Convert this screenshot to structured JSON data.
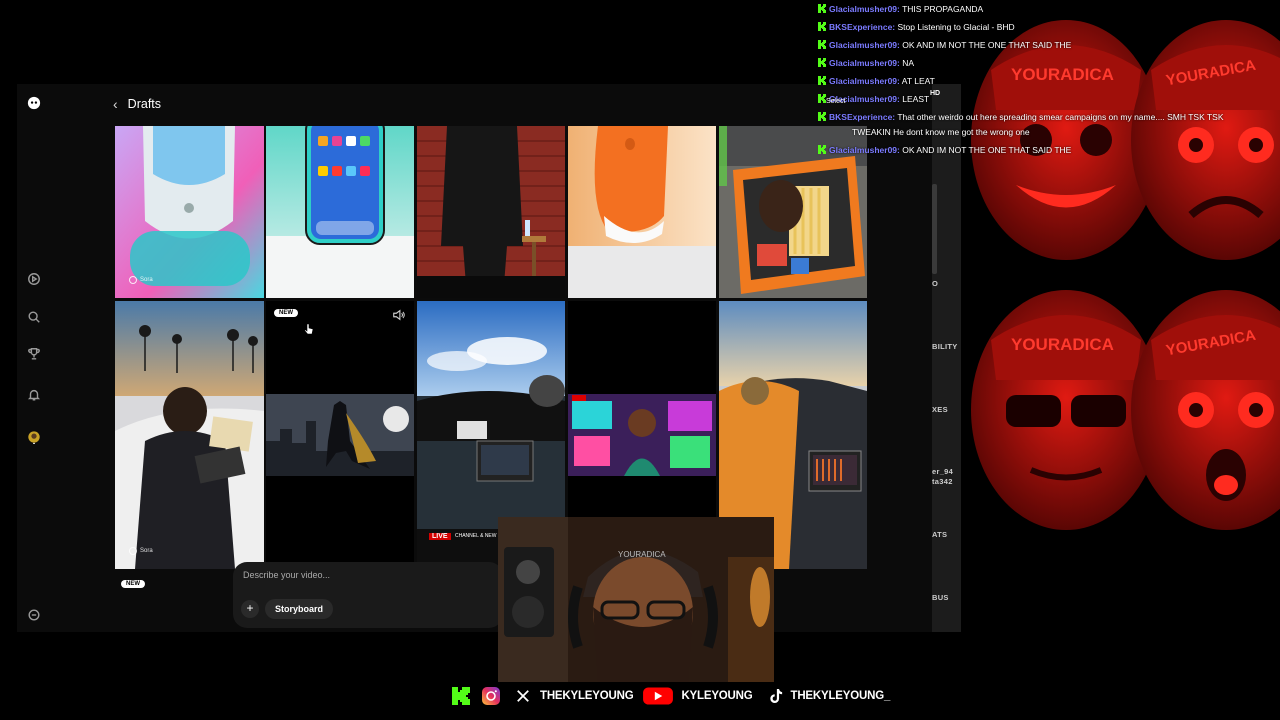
{
  "sora": {
    "header_title": "Drafts",
    "prompt_placeholder": "Describe your video...",
    "storyboard_label": "Storyboard",
    "new_badge": "NEW",
    "watermark": "Sora"
  },
  "chat": {
    "messages": [
      {
        "user": "Glacialmusher09:",
        "text": "THIS PROPAGANDA"
      },
      {
        "user": "BKSExperience:",
        "text": "Stop Listening to Glacial - BHD"
      },
      {
        "user": "Glacialmusher09:",
        "text": "OK AND IM NOT THE ONE THAT SAID THE"
      },
      {
        "user": "Glacialmusher09:",
        "text": "NA"
      },
      {
        "user": "Glacialmusher09:",
        "text": "AT LEAT"
      },
      {
        "user": "Glacialmusher09:",
        "text": "LEAST"
      },
      {
        "user": "BKSExperience:",
        "text": "That other weirdo out here spreading smear campaigns on my name.... SMH TSK TSK"
      },
      {
        "user": "",
        "text": "TWEAKIN He dont know me got the wrong one"
      },
      {
        "user": "Glacialmusher09:",
        "text": "OK AND IM NOT THE ONE THAT SAID THE"
      }
    ],
    "overlap_label": "Select",
    "overlap_label2": "HD"
  },
  "side_panel_fragments": [
    "O",
    "BILITY",
    "XES",
    "er_94",
    "ta342",
    "ATS",
    "BUS"
  ],
  "tiles": {
    "live_badge": "LIVE",
    "live_channel": "CHANNEL & NEW",
    "hat_text": "YOURADICA"
  },
  "socials": {
    "x_handle": "THEKYLEYOUNG",
    "youtube_handle": "KYLEYOUNG",
    "tiktok_handle": "THEKYLEYOUNG_"
  },
  "colors": {
    "chat_username": "#7b7bff",
    "kick_green": "#53fc18",
    "emote_red": "#c8140f",
    "youtube_red": "#ff0000"
  }
}
